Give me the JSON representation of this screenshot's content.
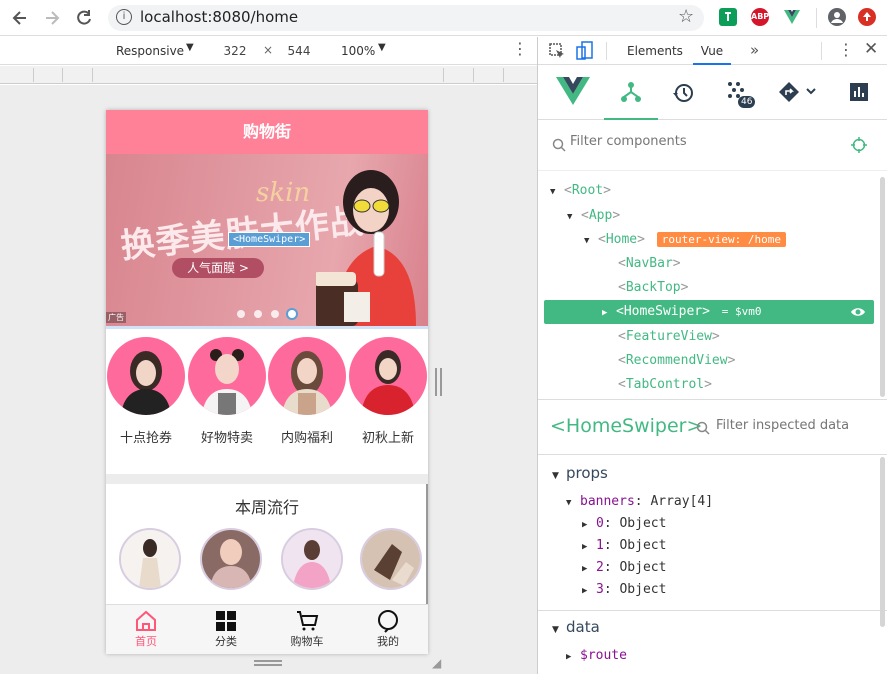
{
  "browser": {
    "url": "localhost:8080/home",
    "extensions": [
      "adblock-icon",
      "abp-icon",
      "vue-devtools-icon",
      "profile-icon",
      "update-icon"
    ],
    "abp_label": "ABP"
  },
  "device_toolbar": {
    "mode": "Responsive",
    "width": "322",
    "times": "×",
    "height": "544",
    "zoom": "100%"
  },
  "app": {
    "navbar_title": "购物街",
    "banner": {
      "headline": "换季美肤大作战",
      "script_text": "skin",
      "button": "人气面膜 >",
      "component_tag": "<HomeSwiper>",
      "ad_label": "广告",
      "dots": 4,
      "active_dot": 3
    },
    "recommend": [
      {
        "label": "十点抢券"
      },
      {
        "label": "好物特卖"
      },
      {
        "label": "内购福利"
      },
      {
        "label": "初秋上新"
      }
    ],
    "feature_title": "本周流行",
    "tabbar": [
      {
        "label": "首页",
        "icon": "home-icon",
        "active": true
      },
      {
        "label": "分类",
        "icon": "grid-icon",
        "active": false
      },
      {
        "label": "购物车",
        "icon": "cart-icon",
        "active": false
      },
      {
        "label": "我的",
        "icon": "chat-icon",
        "active": false
      }
    ],
    "accent": "#ff8198",
    "active_tab_color": "#ff5777"
  },
  "devtools": {
    "tabs": [
      "Elements",
      "Vue"
    ],
    "active_tab": "Vue",
    "more": "»",
    "badge": "46",
    "filter_placeholder": "Filter components",
    "tree": {
      "root": "Root",
      "app": "App",
      "home": "Home",
      "home_badge": "router-view: /home",
      "children": [
        "NavBar",
        "BackTop",
        "HomeSwiper",
        "FeatureView",
        "RecommendView",
        "TabControl"
      ],
      "selected": "HomeSwiper",
      "selected_suffix": "= $vm0"
    },
    "inspector": {
      "component": "<HomeSwiper>",
      "filter_placeholder": "Filter inspected data",
      "props_label": "props",
      "banners_key": "banners",
      "banners_value": "Array[4]",
      "items": [
        {
          "key": "0",
          "value": "Object"
        },
        {
          "key": "1",
          "value": "Object"
        },
        {
          "key": "2",
          "value": "Object"
        },
        {
          "key": "3",
          "value": "Object"
        }
      ],
      "data_label": "data",
      "route_key": "$route"
    }
  },
  "colors": {
    "vue_green": "#42b983",
    "router_badge": "#ff8c42"
  }
}
